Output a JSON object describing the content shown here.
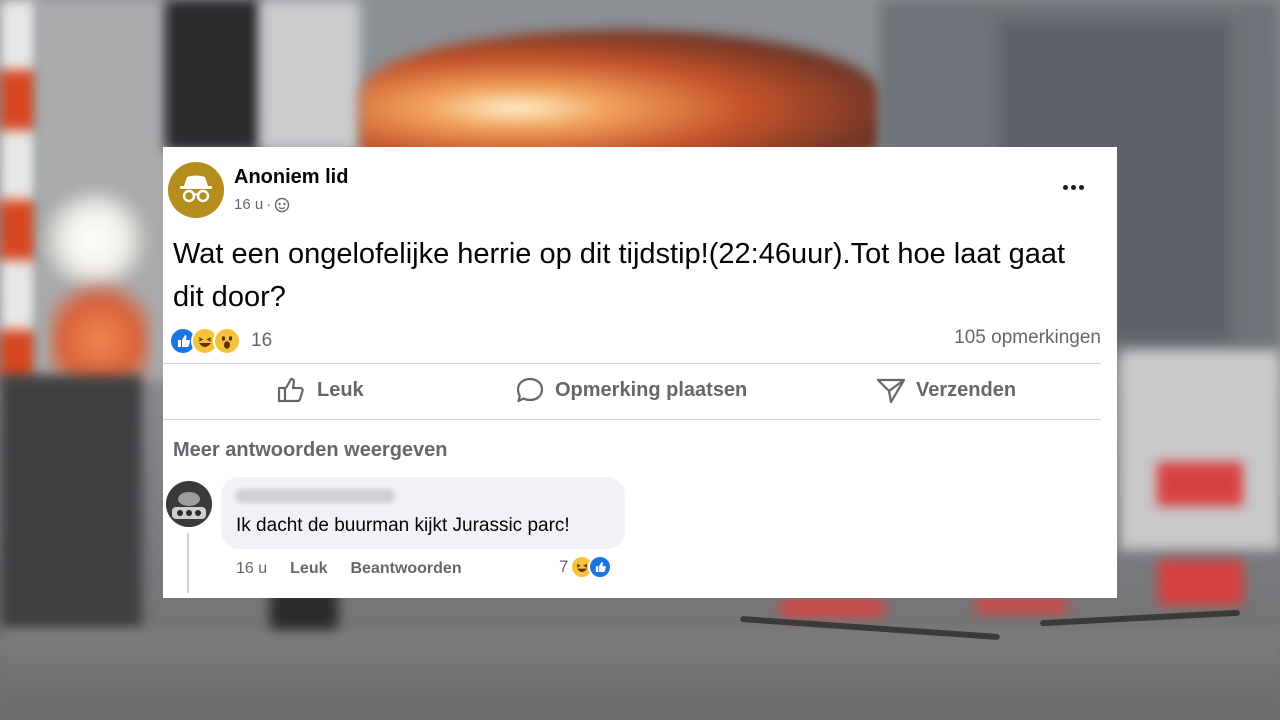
{
  "post": {
    "author": "Anoniem lid",
    "time": "16 u",
    "separator": "·",
    "text": "Wat een ongelofelijke herrie op dit tijdstip!(22:46uur).Tot hoe laat gaat dit door?",
    "reaction_count": "16",
    "comment_count": "105 opmerkingen",
    "actions": {
      "like": "Leuk",
      "comment": "Opmerking plaatsen",
      "share": "Verzenden"
    },
    "more_answers": "Meer antwoorden weergeven"
  },
  "comment": {
    "text": "Ik dacht de buurman kijkt Jurassic parc!",
    "time": "16 u",
    "like": "Leuk",
    "reply": "Beantwoorden",
    "reaction_count": "7"
  },
  "icons": [
    "incognito-icon",
    "globe-icon",
    "more-icon",
    "like-icon",
    "comment-icon",
    "share-icon",
    "like-reaction-icon",
    "haha-reaction-icon",
    "wow-reaction-icon"
  ],
  "colors": {
    "brand_blue": "#1b74e4",
    "muted_text": "#65676b",
    "avatar_gold": "#b58d1c"
  }
}
